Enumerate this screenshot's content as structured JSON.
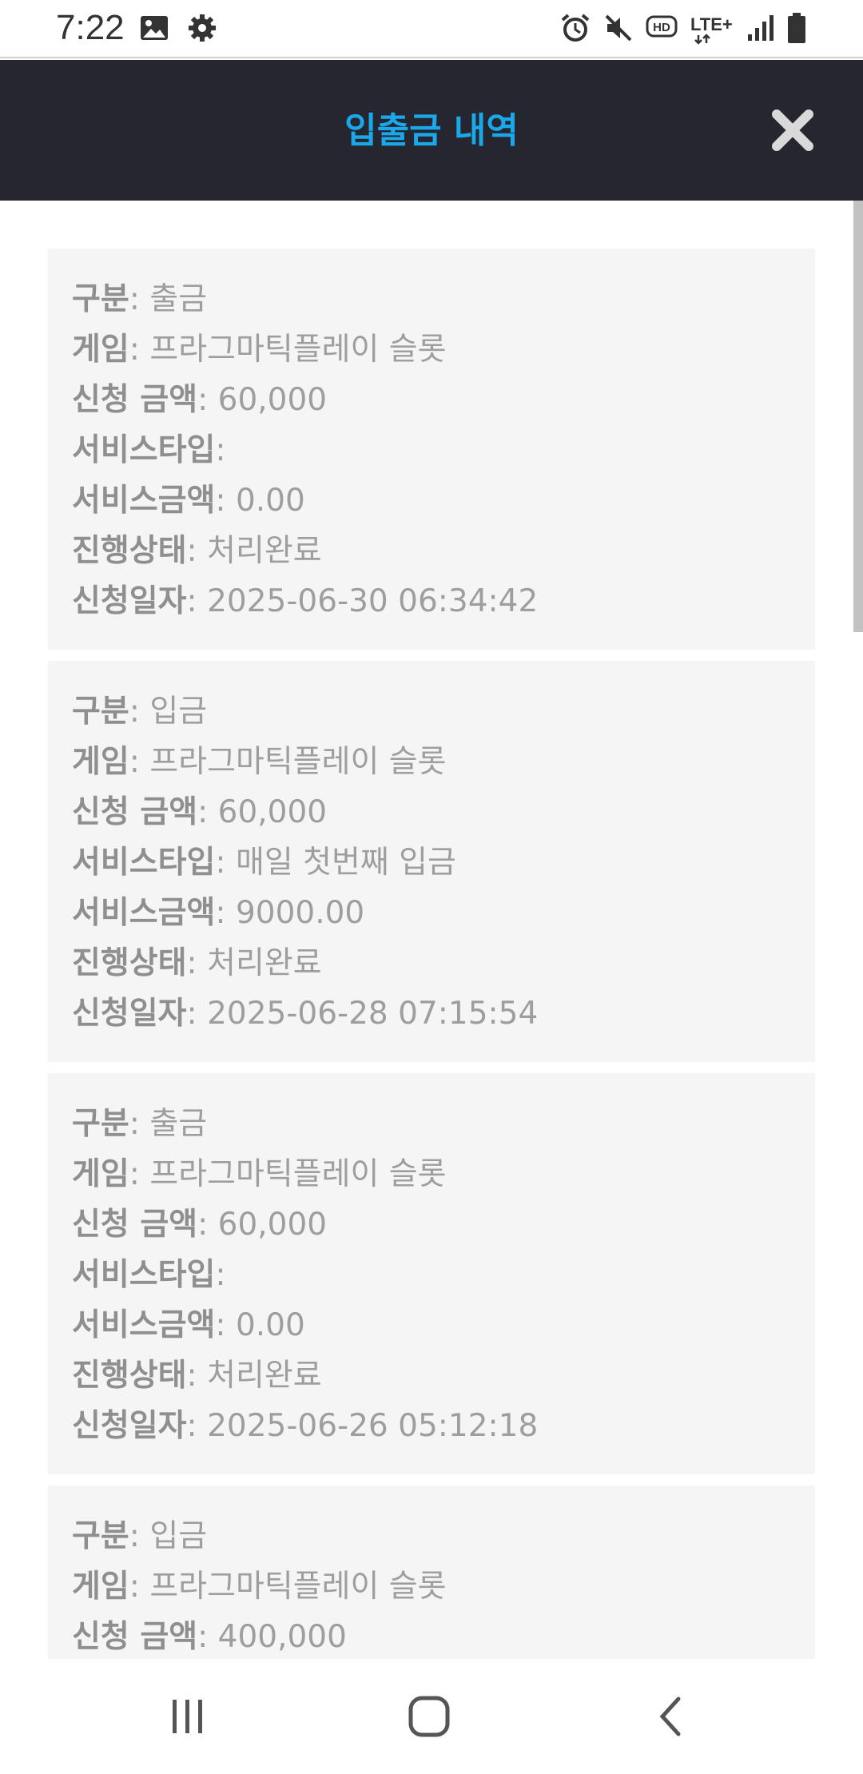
{
  "status_bar": {
    "time": "7:22",
    "left_icons": [
      "image-icon",
      "gear-icon"
    ],
    "right_icons": [
      "alarm-icon",
      "mute-icon",
      "hd-icon",
      "lte-icon",
      "signal-icon",
      "battery-icon"
    ],
    "hd_text": "HD",
    "lte_text": "LTE+"
  },
  "header": {
    "title": "입출금 내역",
    "title_color": "#1aa8e8",
    "background": "#262631"
  },
  "records": [
    {
      "type_label": "구분",
      "type_value": "출금",
      "game_label": "게임",
      "game_value": "프라그마틱플레이 슬롯",
      "amount_label": "신청 금액",
      "amount_value": "60,000",
      "service_type_label": "서비스타입",
      "service_type_value": "",
      "service_amount_label": "서비스금액",
      "service_amount_value": "0.00",
      "status_label": "진행상태",
      "status_value": "처리완료",
      "date_label": "신청일자",
      "date_value": "2025-06-30 06:34:42"
    },
    {
      "type_label": "구분",
      "type_value": "입금",
      "game_label": "게임",
      "game_value": "프라그마틱플레이 슬롯",
      "amount_label": "신청 금액",
      "amount_value": "60,000",
      "service_type_label": "서비스타입",
      "service_type_value": "매일 첫번째 입금",
      "service_amount_label": "서비스금액",
      "service_amount_value": "9000.00",
      "status_label": "진행상태",
      "status_value": "처리완료",
      "date_label": "신청일자",
      "date_value": "2025-06-28 07:15:54"
    },
    {
      "type_label": "구분",
      "type_value": "출금",
      "game_label": "게임",
      "game_value": "프라그마틱플레이 슬롯",
      "amount_label": "신청 금액",
      "amount_value": "60,000",
      "service_type_label": "서비스타입",
      "service_type_value": "",
      "service_amount_label": "서비스금액",
      "service_amount_value": "0.00",
      "status_label": "진행상태",
      "status_value": "처리완료",
      "date_label": "신청일자",
      "date_value": "2025-06-26 05:12:18"
    },
    {
      "type_label": "구분",
      "type_value": "입금",
      "game_label": "게임",
      "game_value": "프라그마틱플레이 슬롯",
      "amount_label": "신청 금액",
      "amount_value": "400,000"
    }
  ],
  "navbar": {
    "icons": [
      "recent-apps-icon",
      "home-icon",
      "back-icon"
    ]
  }
}
